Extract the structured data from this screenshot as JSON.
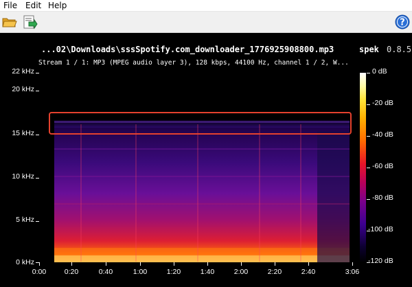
{
  "menu": {
    "items": [
      "File",
      "Edit",
      "Help"
    ]
  },
  "toolbar": {
    "open_icon": "folder-open-icon",
    "save_icon": "save-export-icon",
    "help_icon": "help-icon"
  },
  "viewer": {
    "file_title": "...02\\Downloads\\sssSpotify.com_downloader_1776925908800.mp3",
    "app_name": "spek",
    "version": "0.8.5",
    "stream_info": "Stream 1 / 1: MP3 (MPEG audio layer 3), 128 kbps, 44100 Hz, channel 1 / 2, W...",
    "frequency_axis": [
      "22 kHz",
      "20 kHz",
      "15 kHz",
      "10 kHz",
      "5 kHz",
      "0 kHz"
    ],
    "time_axis": [
      "0:00",
      "0:20",
      "0:40",
      "1:00",
      "1:20",
      "1:40",
      "2:00",
      "2:20",
      "2:40",
      "3:06"
    ],
    "db_scale": [
      "0 dB",
      "-20 dB",
      "-40 dB",
      "-60 dB",
      "-80 dB",
      "-100 dB",
      "-120 dB"
    ]
  },
  "colors": {
    "highlight": "#e5412e",
    "background": "#000000",
    "help_blue": "#2a6fd6"
  }
}
